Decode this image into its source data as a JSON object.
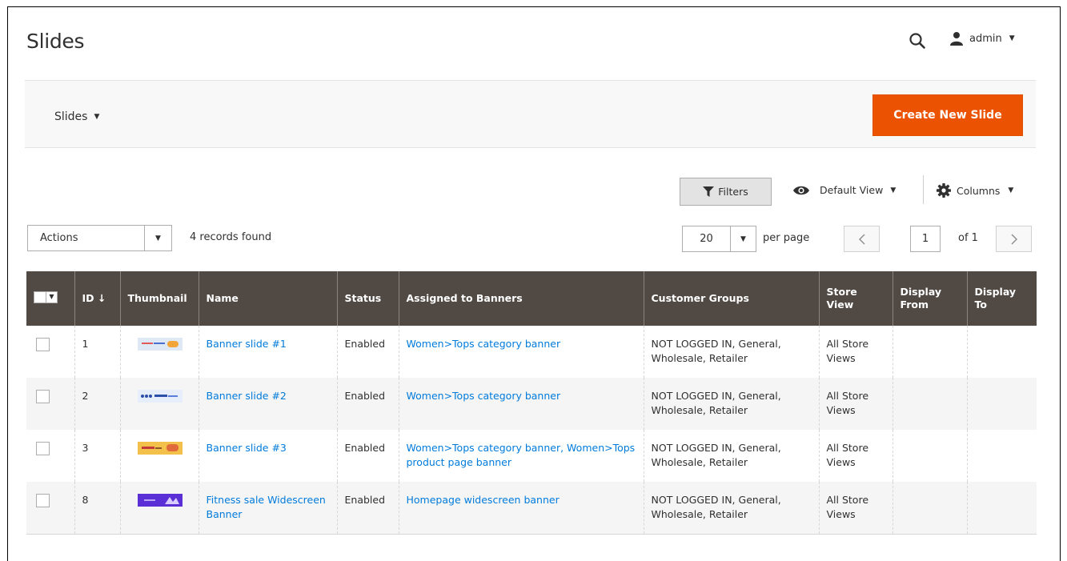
{
  "header": {
    "title": "Slides",
    "user": "admin"
  },
  "switcher": {
    "label": "Slides"
  },
  "toolbar": {
    "create_button": "Create New Slide",
    "filters": "Filters",
    "default_view": "Default View",
    "columns": "Columns",
    "actions": "Actions",
    "records_found": "4 records found",
    "per_page_value": "20",
    "per_page_label": "per page",
    "page_value": "1",
    "page_of": "of 1"
  },
  "grid": {
    "columns": [
      "ID",
      "Thumbnail",
      "Name",
      "Status",
      "Assigned to Banners",
      "Customer Groups",
      "Store View",
      "Display From",
      "Display To"
    ],
    "sort_indicator": "↓",
    "rows": [
      {
        "id": "1",
        "name": "Banner slide #1",
        "status": "Enabled",
        "banners": "Women>Tops category banner",
        "groups": "NOT LOGGED IN, General, Wholesale, Retailer",
        "store": "All Store Views",
        "from": "",
        "to": "",
        "thumb": "thumb-banner-1"
      },
      {
        "id": "2",
        "name": "Banner slide #2",
        "status": "Enabled",
        "banners": "Women>Tops category banner",
        "groups": "NOT LOGGED IN, General, Wholesale, Retailer",
        "store": "All Store Views",
        "from": "",
        "to": "",
        "thumb": "thumb-banner-2"
      },
      {
        "id": "3",
        "name": "Banner slide #3",
        "status": "Enabled",
        "banners": "Women>Tops category banner, Women>Tops product page banner",
        "groups": "NOT LOGGED IN, General, Wholesale, Retailer",
        "store": "All Store Views",
        "from": "",
        "to": "",
        "thumb": "thumb-banner-3"
      },
      {
        "id": "8",
        "name": "Fitness sale Widescreen Banner",
        "status": "Enabled",
        "banners": "Homepage widescreen banner",
        "groups": "NOT LOGGED IN, General, Wholesale, Retailer",
        "store": "All Store Views",
        "from": "",
        "to": "",
        "thumb": "thumb-fitness"
      }
    ]
  },
  "colors": {
    "accent": "#eb5202",
    "grid_header": "#514943",
    "link": "#007bdb"
  },
  "icons": [
    "search-icon",
    "user-icon",
    "filter-icon",
    "eye-icon",
    "gear-icon",
    "chevron-left-icon",
    "chevron-right-icon"
  ]
}
